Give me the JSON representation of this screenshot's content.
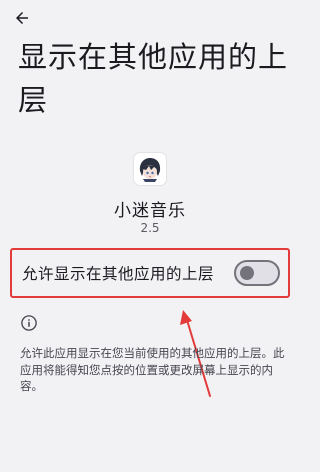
{
  "header": {
    "back_icon": "arrow-left-icon",
    "title": "显示在其他应用的上层"
  },
  "app": {
    "icon": "anime-avatar-icon",
    "name": "小迷音乐",
    "version": "2.5"
  },
  "permission": {
    "label": "允许显示在其他应用的上层",
    "enabled": false
  },
  "info": {
    "icon": "info-icon",
    "text": "允许此应用显示在您当前使用的其他应用的上层。此应用将能得知您点按的位置或更改屏幕上显示的内容。"
  },
  "colors": {
    "background": "#f2f1f4",
    "highlight_box": "#e33a3a",
    "switch_off": "#74737b"
  }
}
